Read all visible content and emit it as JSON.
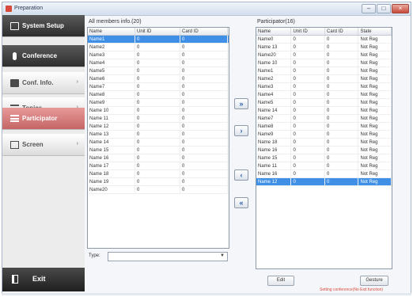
{
  "window": {
    "title": "Preparation"
  },
  "sidebar": {
    "items": [
      {
        "label": "System Setup",
        "icon": "monitor-icon"
      },
      {
        "label": "Conference",
        "icon": "microphone-icon"
      },
      {
        "label": "Conf. Info.",
        "icon": "info-icon"
      },
      {
        "label": "Topics",
        "icon": "list-icon"
      },
      {
        "label": "Participator",
        "icon": "list-icon"
      },
      {
        "label": "Screen",
        "icon": "screen-icon"
      }
    ],
    "exit": {
      "label": "Exit",
      "icon": "exit-icon"
    }
  },
  "left_panel": {
    "title": "All members info.(20)",
    "columns": [
      "Name",
      "Unit ID",
      "Card ID"
    ],
    "rows": [
      [
        "Name1",
        "0",
        "0"
      ],
      [
        "Name2",
        "0",
        "0"
      ],
      [
        "Name3",
        "0",
        "0"
      ],
      [
        "Name4",
        "0",
        "0"
      ],
      [
        "Name5",
        "0",
        "0"
      ],
      [
        "Name6",
        "0",
        "0"
      ],
      [
        "Name7",
        "0",
        "0"
      ],
      [
        "Name8",
        "0",
        "0"
      ],
      [
        "Name9",
        "0",
        "0"
      ],
      [
        "Name 10",
        "0",
        "0"
      ],
      [
        "Name 11",
        "0",
        "0"
      ],
      [
        "Name 12",
        "0",
        "0"
      ],
      [
        "Name 13",
        "0",
        "0"
      ],
      [
        "Name 14",
        "0",
        "0"
      ],
      [
        "Name 15",
        "0",
        "0"
      ],
      [
        "Name 16",
        "0",
        "0"
      ],
      [
        "Name 17",
        "0",
        "0"
      ],
      [
        "Name 18",
        "0",
        "0"
      ],
      [
        "Name 19",
        "0",
        "0"
      ],
      [
        "Name20",
        "0",
        "0"
      ]
    ],
    "selected_index": 0
  },
  "transfer_buttons": {
    "add_all": "»",
    "add": "›",
    "remove": "‹",
    "remove_all": "«"
  },
  "right_panel": {
    "title": "Participator(16)",
    "columns": [
      "Name",
      "Unit ID",
      "Card ID",
      "State"
    ],
    "rows": [
      [
        "Name0",
        "0",
        "0",
        "Not Reg"
      ],
      [
        "Name 13",
        "0",
        "0",
        "Not Reg"
      ],
      [
        "Name20",
        "0",
        "0",
        "Not Reg"
      ],
      [
        "Name 10",
        "0",
        "0",
        "Not Reg"
      ],
      [
        "Name1",
        "0",
        "0",
        "Not Reg"
      ],
      [
        "Name2",
        "0",
        "0",
        "Not Reg"
      ],
      [
        "Name3",
        "0",
        "0",
        "Not Reg"
      ],
      [
        "Name4",
        "0",
        "0",
        "Not Reg"
      ],
      [
        "Name5",
        "0",
        "0",
        "Not Reg"
      ],
      [
        "Name 14",
        "0",
        "0",
        "Not Reg"
      ],
      [
        "Name7",
        "0",
        "0",
        "Not Reg"
      ],
      [
        "Name8",
        "0",
        "0",
        "Not Reg"
      ],
      [
        "Name9",
        "0",
        "0",
        "Not Reg"
      ],
      [
        "Name 18",
        "0",
        "0",
        "Not Reg"
      ],
      [
        "Name 16",
        "0",
        "0",
        "Not Reg"
      ],
      [
        "Name 15",
        "0",
        "0",
        "Not Reg"
      ],
      [
        "Name 11",
        "0",
        "0",
        "Not Reg"
      ],
      [
        "Name 16",
        "0",
        "0",
        "Not Reg"
      ],
      [
        "Name 12",
        "0",
        "0",
        "Not Reg"
      ]
    ],
    "selected_index": 18
  },
  "type_field": {
    "label": "Type:",
    "value": ""
  },
  "buttons": {
    "edit": "Edit",
    "gesture": "Gesture"
  },
  "status": "Setting conference(No Exit function)",
  "colors": {
    "selection": "#3f8fe6",
    "active_nav": "#c56565",
    "status_text": "#d84b3c"
  }
}
